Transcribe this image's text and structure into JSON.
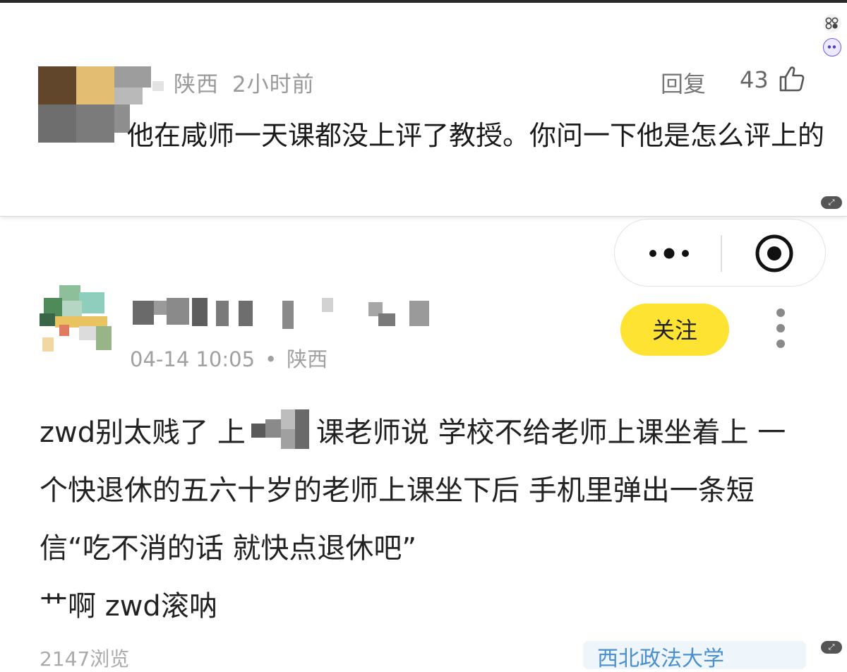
{
  "comment": {
    "location": "陕西",
    "time_ago": "2小时前",
    "reply_label": "回复",
    "like_count": "43",
    "text": "他在咸师一天课都没上评了教授。你问一下他是怎么评上的"
  },
  "capsule": {
    "more_icon": "more-dots-icon",
    "close_icon": "target-circle-icon"
  },
  "post": {
    "datetime": "04-14 10:05",
    "separator": "•",
    "location": "陕西",
    "follow_label": "关注",
    "body_part1": "zwd别太贱了 上",
    "body_part2": "课老师说 学校不给老师上课坐着上 一个快退休的五六十岁的老师上课坐下后 手机里弹出一条短信“吃不消的话 就快点退休吧”",
    "body_part3": "艹啊 zwd滚呐",
    "views": "2147浏览",
    "school_tag": "西北政法大学"
  },
  "colors": {
    "follow_yellow": "#ffe333",
    "tag_blue": "#4a8fd0",
    "meta_gray": "#a0a0a0"
  }
}
